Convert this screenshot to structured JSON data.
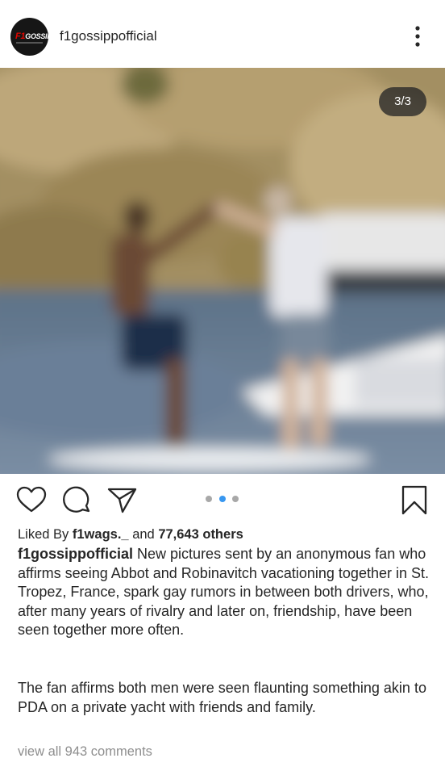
{
  "post": {
    "username": "f1gossippofficial",
    "avatar_text": "F1",
    "avatar_subtext": "GOSSIPP",
    "image_counter": "3/3",
    "carousel": {
      "count": 3,
      "active_index": 1
    },
    "likes": {
      "prefix": "Liked By",
      "liker": "f1wags._",
      "middle": "and",
      "others": "77,643 others"
    },
    "caption": {
      "author": "f1gossippofficial",
      "text": "New pictures sent by an anonymous fan who affirms seeing Abbot and Robinavitch vacationing together in St. Tropez, France, spark gay rumors in between both drivers, who, after many years of rivalry and later on, friendship, have been seen together more often.",
      "text2": "The fan affirms both men were seen flaunting something akin to PDA on a private yacht with friends and family."
    },
    "comments_link": "view all 943 comments"
  },
  "icons": {
    "more": "more-vertical-icon",
    "like": "heart-icon",
    "comment": "comment-bubble-icon",
    "share": "paper-plane-icon",
    "save": "bookmark-icon"
  },
  "colors": {
    "text": "#262626",
    "muted": "#8e8e8e",
    "dot_active": "#3897f0",
    "dot_inactive": "#a8a8a8"
  }
}
